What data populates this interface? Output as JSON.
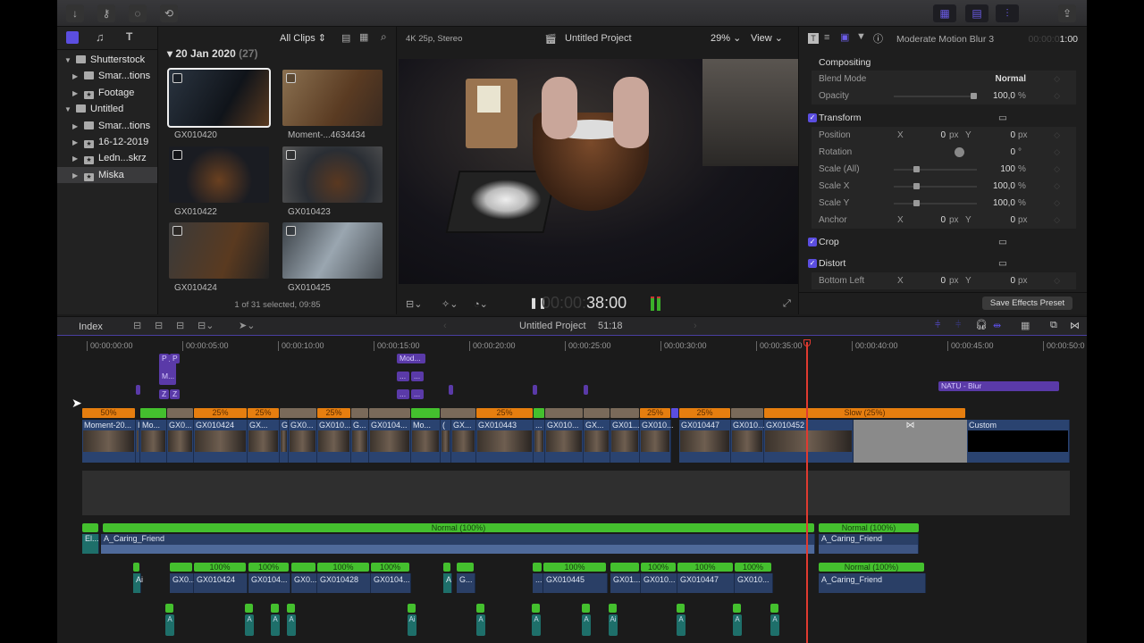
{
  "toolbar": {
    "left_icons": [
      "import-arrow-icon",
      "keyword-icon",
      "background-tasks-icon",
      "transform-arrows-icon"
    ],
    "right_icons": [
      "browser-layout-icon",
      "timeline-layout-icon",
      "inspector-layout-icon",
      "share-icon"
    ]
  },
  "library": {
    "items": [
      {
        "label": "Shutterstock",
        "level": 0,
        "expanded": true,
        "icon": "library-icon"
      },
      {
        "label": "Smar...tions",
        "level": 1,
        "icon": "folder-icon"
      },
      {
        "label": "Footage",
        "level": 1,
        "icon": "event-star-icon"
      },
      {
        "label": "Untitled",
        "level": 0,
        "expanded": true,
        "icon": "library-icon"
      },
      {
        "label": "Smar...tions",
        "level": 1,
        "icon": "folder-icon"
      },
      {
        "label": "16-12-2019",
        "level": 1,
        "icon": "event-star-icon"
      },
      {
        "label": "Ledn...skrz",
        "level": 1,
        "icon": "event-star-icon"
      },
      {
        "label": "Miska",
        "level": 1,
        "icon": "event-star-icon",
        "selected": true
      }
    ]
  },
  "browser": {
    "filter": "All Clips",
    "group_date": "20 Jan 2020",
    "group_count": "(27)",
    "status": "1 of 31 selected, 09:85",
    "clips": [
      "GX010420",
      "Moment-...4634434",
      "GX010422",
      "GX010423",
      "GX010424",
      "GX010425"
    ]
  },
  "viewer": {
    "format": "4K 25p, Stereo",
    "project": "Untitled Project",
    "zoom": "29%",
    "view": "View",
    "timecode_dim": "00:00:",
    "timecode": "38:00"
  },
  "inspector": {
    "effect_name": "Moderate Motion Blur 3",
    "timecode_dim": "00:00:0",
    "timecode": "1:00",
    "compositing": "Compositing",
    "blend_mode_label": "Blend Mode",
    "blend_mode": "Normal",
    "opacity_label": "Opacity",
    "opacity": "100,0",
    "opacity_unit": "%",
    "opacity_level": 1.0,
    "transform": "Transform",
    "position_label": "Position",
    "position_x": "0",
    "position_y": "0",
    "rotation_label": "Rotation",
    "rotation": "0",
    "rotation_unit": "°",
    "scale_all_label": "Scale (All)",
    "scale_all": "100",
    "scale_x_label": "Scale X",
    "scale_x": "100,0",
    "scale_y_label": "Scale Y",
    "scale_y": "100,0",
    "pct": "%",
    "anchor_label": "Anchor",
    "anchor_x": "0",
    "anchor_y": "0",
    "crop": "Crop",
    "distort": "Distort",
    "bottom_left_label": "Bottom Left",
    "bottom_left_x": "0",
    "bottom_left_y": "0",
    "x": "X",
    "y": "Y",
    "px": "px",
    "save_preset": "Save Effects Preset"
  },
  "timeline": {
    "index": "Index",
    "project": "Untitled Project",
    "duration": "51:18",
    "ruler": [
      "00:00:00:00",
      "00:00:05:00",
      "00:00:10:00",
      "00:00:15:00",
      "00:00:20:00",
      "00:00:25:00",
      "00:00:30:00",
      "00:00:35:00",
      "00:00:40:00",
      "00:00:45:00",
      "00:00:50:0"
    ],
    "titles": [
      "M...",
      "P",
      "P",
      "M...",
      "Z",
      "Z",
      "Mod...",
      "...",
      "...",
      "...",
      "...",
      "NATU - Blur"
    ],
    "primary": [
      "Moment-20...",
      "I",
      "Mo...",
      "GX0...",
      "GX010424",
      "GX...",
      "G",
      "GX0...",
      "GX010...",
      "G...",
      "GX0104...",
      "Mo...",
      "(",
      "GX...",
      "GX010443",
      "...",
      "GX010...",
      "GX...",
      "GX01...",
      "GX010...",
      "GX010447",
      "GX010...",
      "GX010452",
      "Custom"
    ],
    "speeds": [
      "50%",
      "25%",
      "25%",
      "25%",
      "25%",
      "25%",
      "25%",
      "Slow (25%)"
    ],
    "music": {
      "lead": "El...",
      "name": "A_Caring_Friend",
      "retime": "Normal (100%)",
      "name2": "A_Caring_Friend",
      "retime2": "Normal (100%)"
    },
    "audio": [
      "Ai",
      "GX0...",
      "GX010424",
      "GX0104...",
      "GX0...",
      "GX010428",
      "GX0104...",
      "A",
      "G...",
      "...",
      "GX010445",
      "GX01...",
      "GX010...",
      "GX010447",
      "GX010...",
      "A_Caring_Friend"
    ],
    "audio_speeds": [
      "100%",
      "100%",
      "100%",
      "100%",
      "100%",
      "100%",
      "100%",
      "100%",
      "Normal (100%)"
    ],
    "small_audio": [
      "A",
      "A",
      "A",
      "A",
      "Ai",
      "A",
      "A",
      "A",
      "Ai",
      "A",
      "A",
      "A"
    ],
    "colors": {
      "speed": "#e67e0f",
      "green": "#44c02e",
      "clip": "#2a4370",
      "title": "#5a3aa8",
      "playhead": "#e03a30"
    }
  }
}
